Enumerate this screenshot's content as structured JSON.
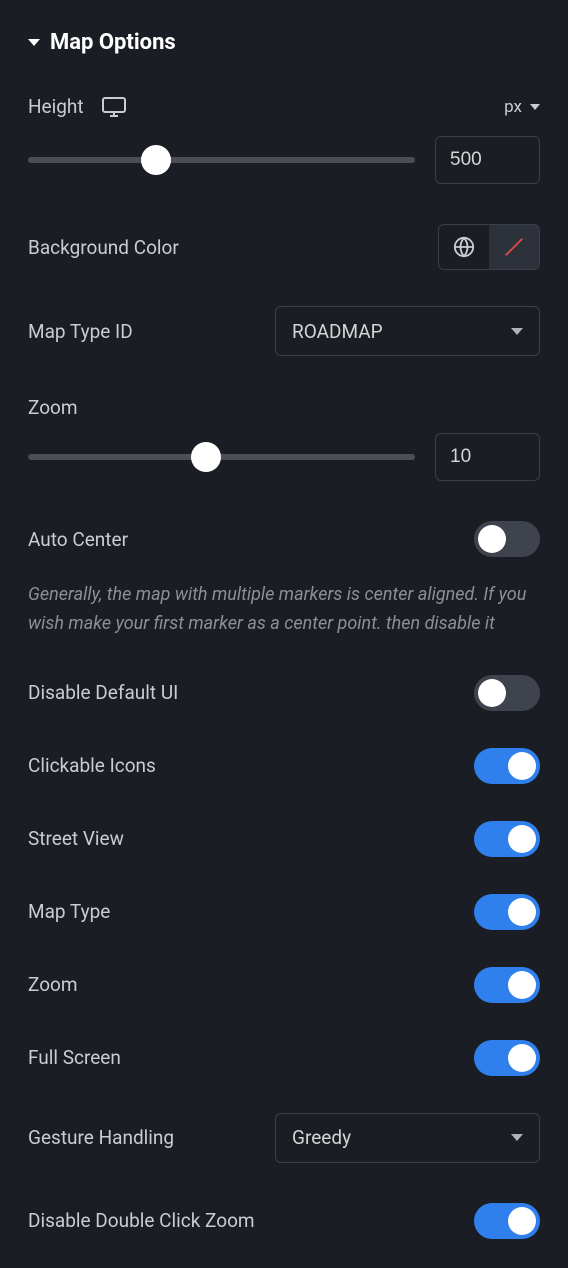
{
  "section": {
    "title": "Map Options"
  },
  "height": {
    "label": "Height",
    "unit": "px",
    "value": "500",
    "sliderPercent": 33
  },
  "backgroundColor": {
    "label": "Background Color"
  },
  "mapTypeId": {
    "label": "Map Type ID",
    "value": "ROADMAP"
  },
  "zoom": {
    "label": "Zoom",
    "value": "10",
    "sliderPercent": 46
  },
  "autoCenter": {
    "label": "Auto Center",
    "enabled": false,
    "help": "Generally, the map with multiple markers is center aligned. If you wish make your first marker as a center point. then disable it"
  },
  "disableDefaultUI": {
    "label": "Disable Default UI",
    "enabled": false
  },
  "clickableIcons": {
    "label": "Clickable Icons",
    "enabled": true
  },
  "streetView": {
    "label": "Street View",
    "enabled": true
  },
  "mapType": {
    "label": "Map Type",
    "enabled": true
  },
  "zoomControl": {
    "label": "Zoom",
    "enabled": true
  },
  "fullScreen": {
    "label": "Full Screen",
    "enabled": true
  },
  "gestureHandling": {
    "label": "Gesture Handling",
    "value": "Greedy"
  },
  "disableDoubleClickZoom": {
    "label": "Disable Double Click Zoom",
    "enabled": true
  }
}
